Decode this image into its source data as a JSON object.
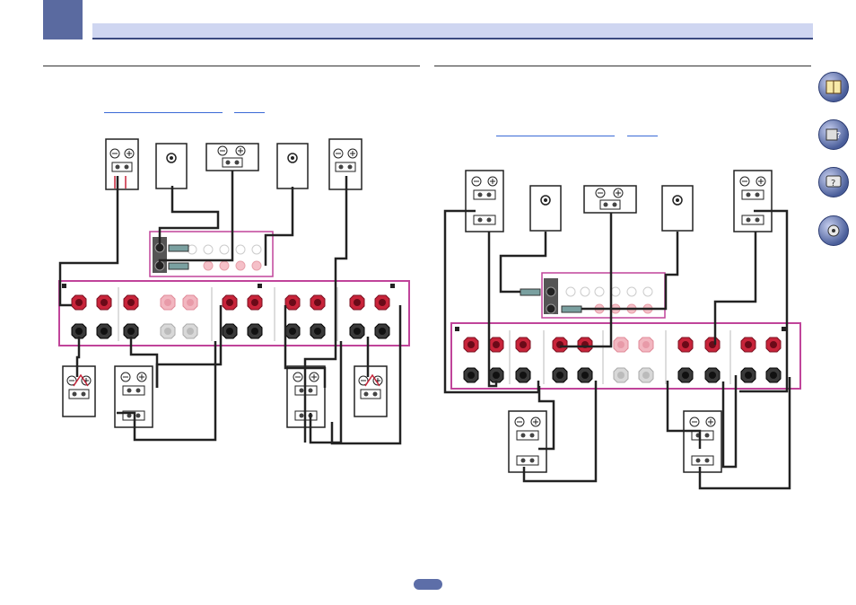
{
  "page": {
    "chapter_tab": "",
    "header_title": "",
    "page_number": ""
  },
  "side_nav": {
    "items": [
      {
        "icon": "manual-book-icon"
      },
      {
        "icon": "receiver-help-icon"
      },
      {
        "icon": "faq-icon"
      },
      {
        "icon": "settings-tools-icon"
      }
    ]
  },
  "sections": [
    {
      "id": "left",
      "diagram": "speaker-wiring-layout-a"
    },
    {
      "id": "right",
      "diagram": "speaker-wiring-layout-b"
    }
  ],
  "colors": {
    "accent_tab": "#5a6aa0",
    "header_bar": "#cfd6f1",
    "panel_border": "#c0449a",
    "terminal_red": "#c8243a",
    "terminal_black": "#222222",
    "link": "#3a6ad6"
  }
}
